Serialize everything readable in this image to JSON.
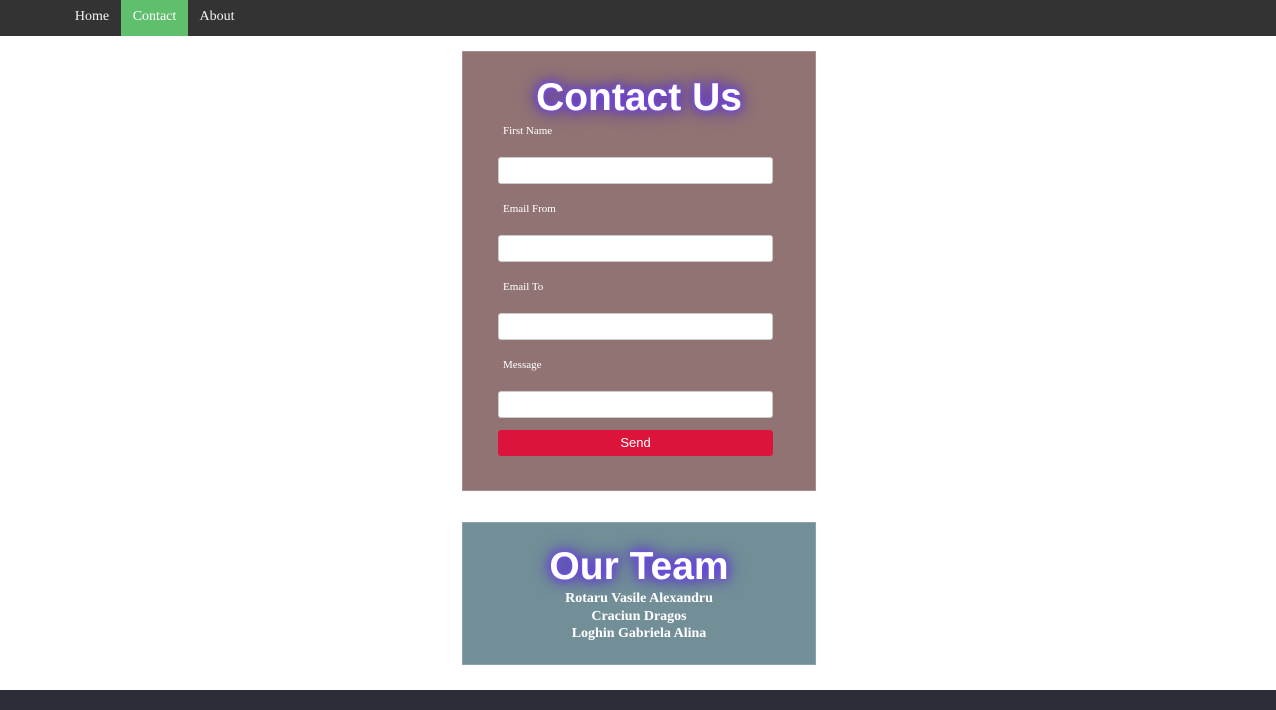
{
  "nav": {
    "items": [
      {
        "label": "Home",
        "active": false
      },
      {
        "label": "Contact",
        "active": true
      },
      {
        "label": "About",
        "active": false
      }
    ]
  },
  "contact": {
    "title": "Contact Us",
    "fields": [
      {
        "label": "First Name",
        "value": ""
      },
      {
        "label": "Email From",
        "value": ""
      },
      {
        "label": "Email To",
        "value": ""
      },
      {
        "label": "Message",
        "value": ""
      }
    ],
    "send_label": "Send"
  },
  "team": {
    "title": "Our Team",
    "members": [
      "Rotaru Vasile Alexandru",
      "Craciun Dragos",
      "Loghin Gabriela Alina"
    ]
  },
  "colors": {
    "navbar": "#333333",
    "nav_active": "#5fbf6c",
    "contact_card": "#917373",
    "send_button": "#dc143c",
    "team_card": "#728f98",
    "footer": "#2b2d36",
    "title_glow": "#7b4dff"
  }
}
